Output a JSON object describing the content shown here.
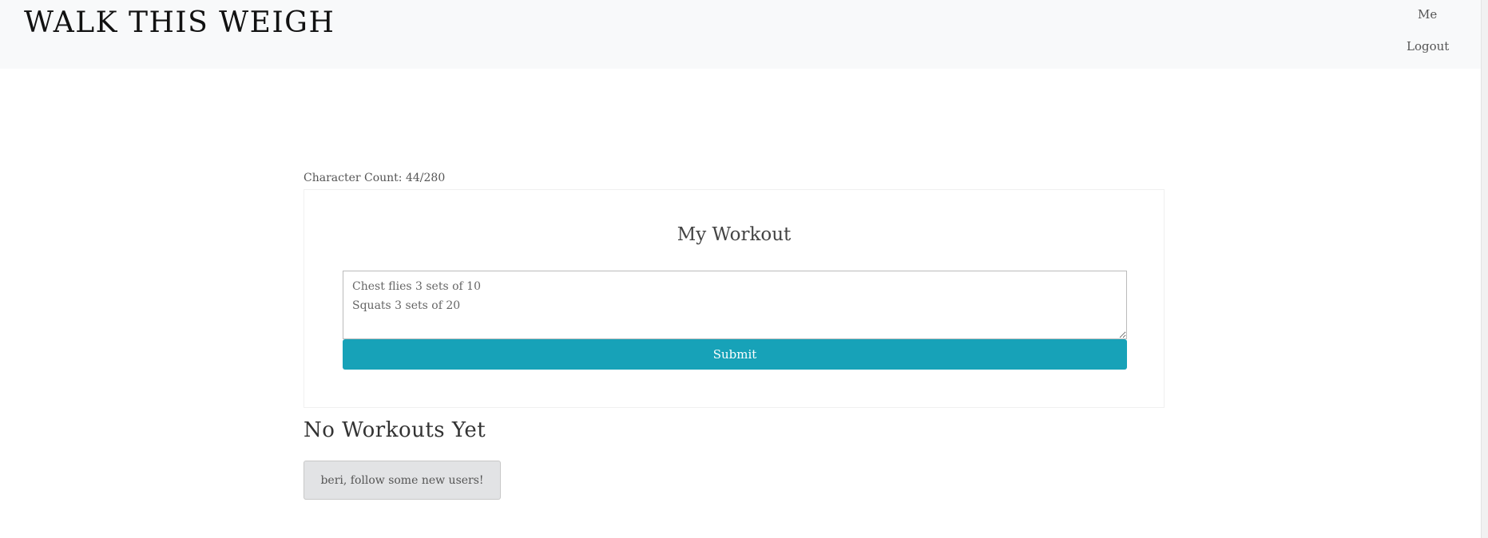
{
  "navbar": {
    "brand": "WALK THIS WEIGH",
    "links": {
      "me": "Me",
      "logout": "Logout"
    }
  },
  "composer": {
    "character_count_label": "Character Count: 44/280",
    "title": "My Workout",
    "input_value": "Chest flies 3 sets of 10\nSquats 3 sets of 20",
    "submit_label": "Submit"
  },
  "feed": {
    "empty_heading": "No Workouts Yet",
    "follow_prompt": "beri, follow some new users!"
  },
  "colors": {
    "navbar_bg": "#f8f9fa",
    "accent": "#17a2b8",
    "secondary_button": "#e2e3e5"
  }
}
